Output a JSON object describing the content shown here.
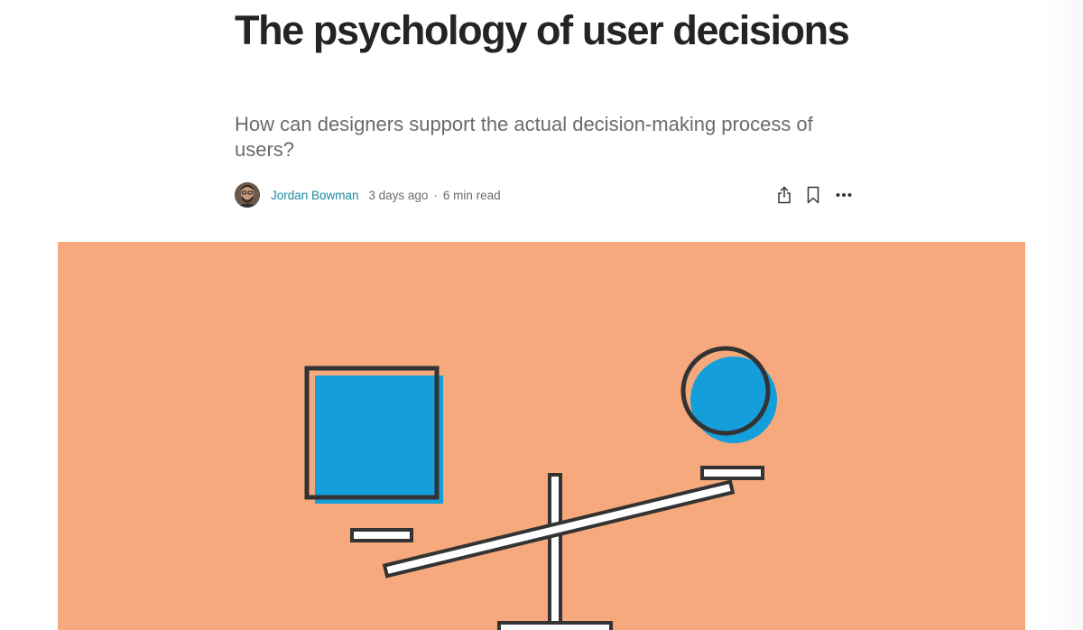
{
  "article": {
    "title": "The psychology of user decisions",
    "subtitle": "How can designers support the actual decision-making process of users?"
  },
  "byline": {
    "author": "Jordan Bowman",
    "published": "3 days ago",
    "separator": "·",
    "read_time": "6 min read"
  },
  "hero": {
    "background_color": "#f5a97c",
    "shape_fill_color": "#149fdb",
    "outline_color": "#333333"
  },
  "icons": {
    "share": "share-icon",
    "bookmark": "bookmark-icon",
    "more": "more-icon"
  }
}
